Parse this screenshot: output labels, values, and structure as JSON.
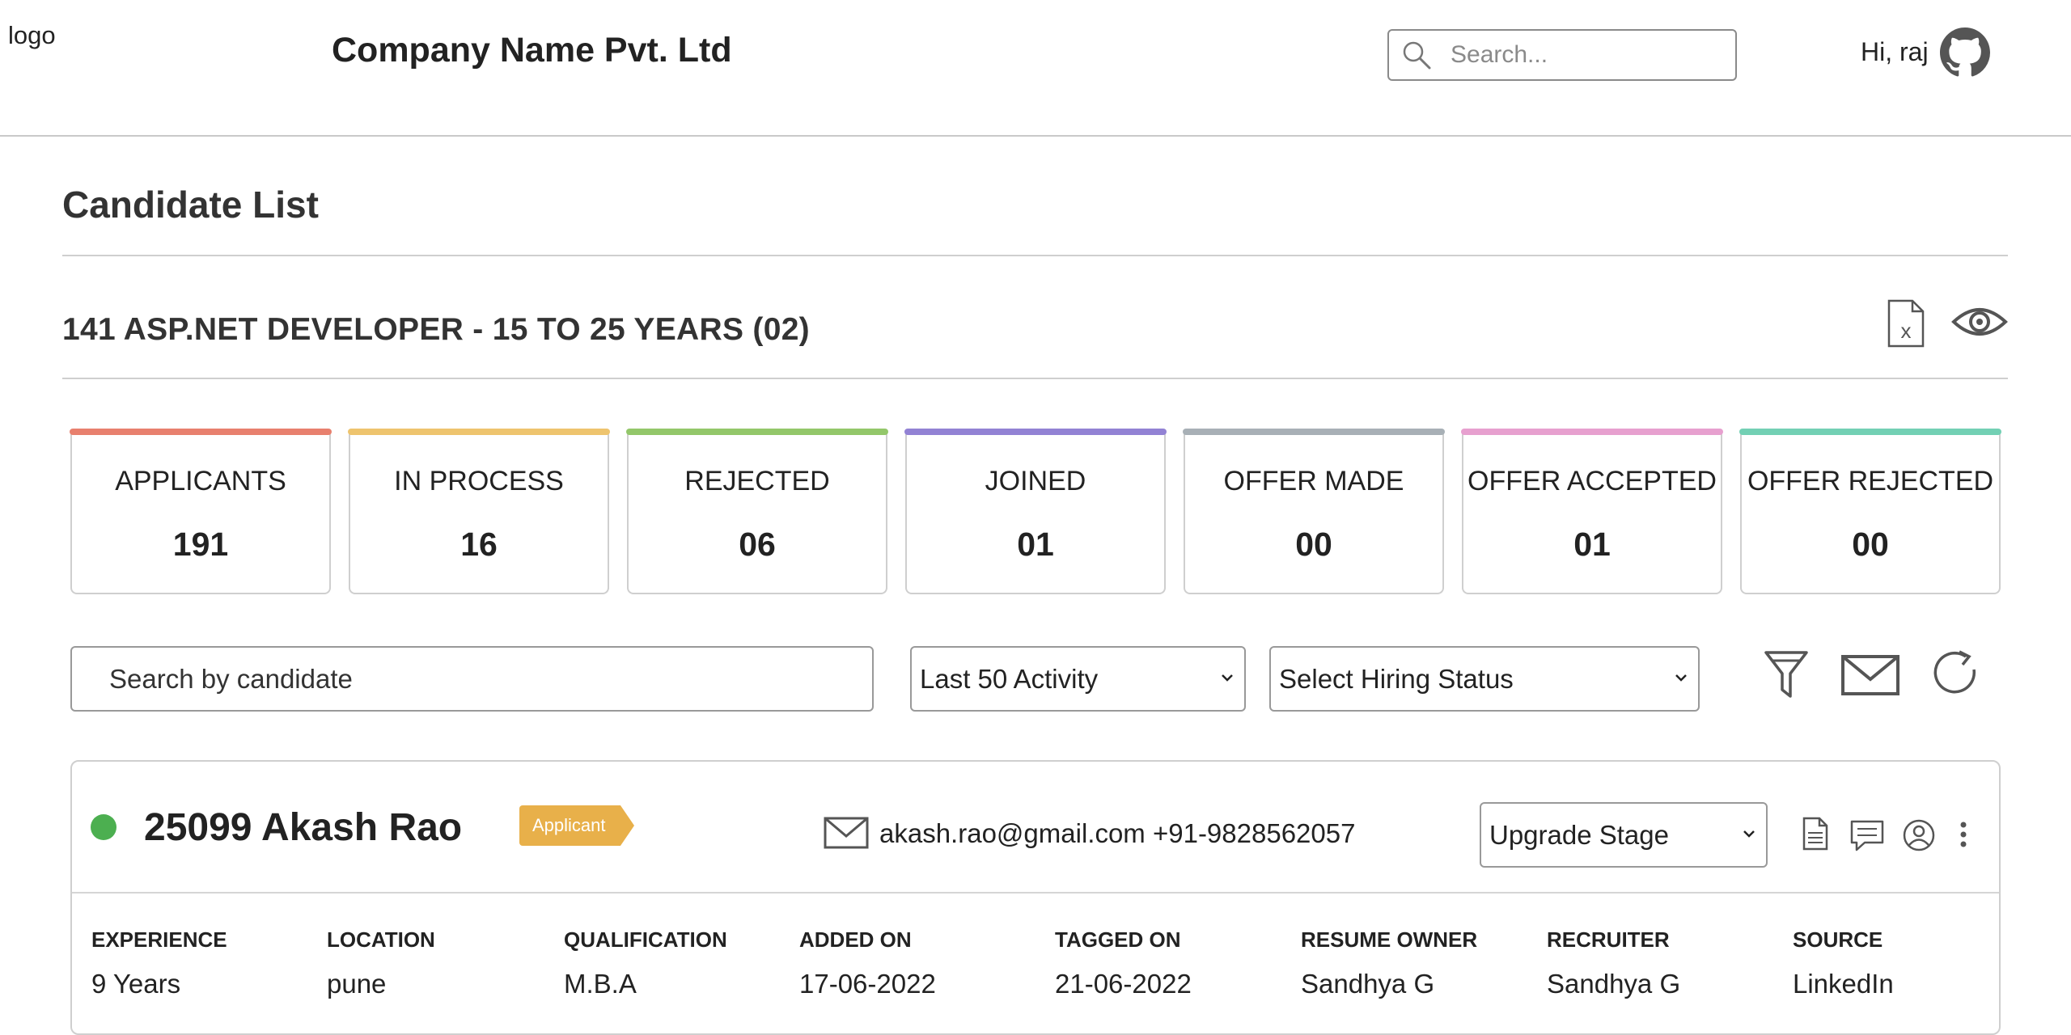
{
  "header": {
    "logo": "logo",
    "company": "Company Name Pvt. Ltd",
    "search_placeholder": "Search...",
    "greeting": "Hi, raj"
  },
  "page": {
    "title": "Candidate List",
    "job_title": "141 ASP.NET DEVELOPER - 15 TO 25 YEARS (02)"
  },
  "stats": [
    {
      "label": "APPLICANTS",
      "value": "191",
      "color": "#e8806e"
    },
    {
      "label": "IN PROCESS",
      "value": "16",
      "color": "#eec46e"
    },
    {
      "label": "REJECTED",
      "value": "06",
      "color": "#93c76a"
    },
    {
      "label": "JOINED",
      "value": "01",
      "color": "#9282d4"
    },
    {
      "label": "OFFER MADE",
      "value": "00",
      "color": "#a8b0b6"
    },
    {
      "label": "OFFER ACCEPTED",
      "value": "01",
      "color": "#e7a0cf"
    },
    {
      "label": "OFFER REJECTED",
      "value": "00",
      "color": "#73d0b4"
    }
  ],
  "filters": {
    "candidate_search_placeholder": "Search by candidate",
    "activity": "Last 50 Activity",
    "hiring_status": "Select Hiring Status"
  },
  "candidate": {
    "name": "25099 Akash Rao",
    "badge": "Applicant",
    "contact": "akash.rao@gmail.com +91-9828562057",
    "stage_select": "Upgrade Stage",
    "status_color": "#4caf50",
    "columns": [
      {
        "header": "EXPERIENCE",
        "value": "9 Years"
      },
      {
        "header": "LOCATION",
        "value": "pune"
      },
      {
        "header": "QUALIFICATION",
        "value": "M.B.A"
      },
      {
        "header": "ADDED ON",
        "value": "17-06-2022"
      },
      {
        "header": "TAGGED ON",
        "value": "21-06-2022"
      },
      {
        "header": "RESUME OWNER",
        "value": "Sandhya G"
      },
      {
        "header": "RECRUITER",
        "value": "Sandhya G"
      },
      {
        "header": "SOURCE",
        "value": "LinkedIn"
      }
    ]
  }
}
